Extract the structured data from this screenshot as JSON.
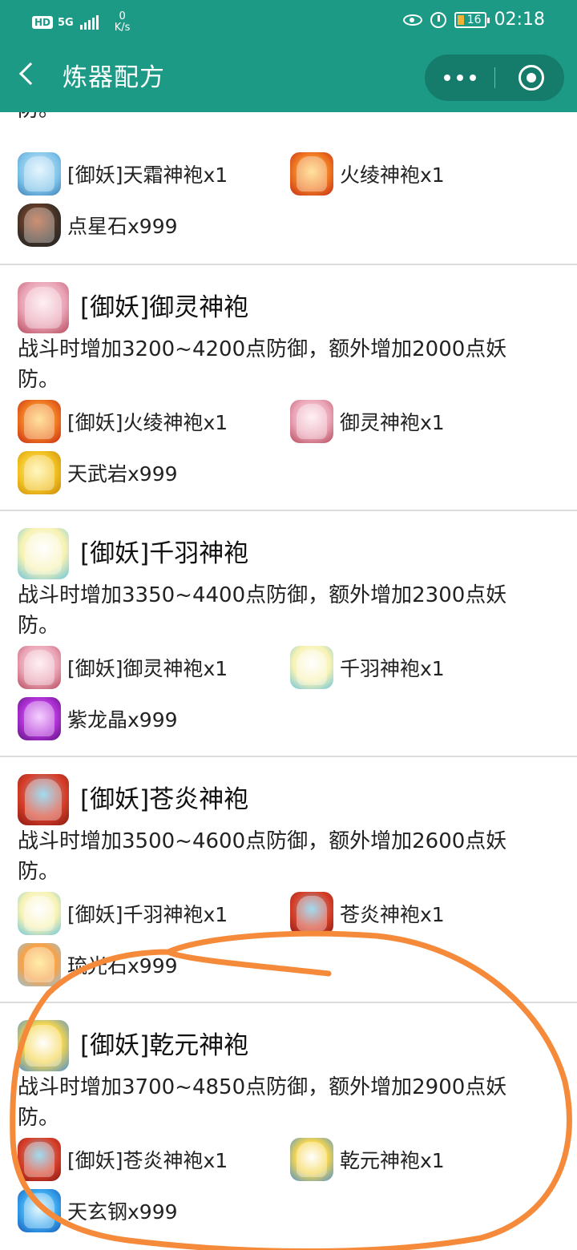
{
  "status_bar": {
    "hd": "HD",
    "network": "5G",
    "speed_value": "0",
    "speed_unit": "K/s",
    "battery": "16",
    "time": "02:18"
  },
  "nav": {
    "title": "炼器配方"
  },
  "partial_item": {
    "desc_tail": "防。",
    "materials": [
      {
        "icon": "frost-robe-icon",
        "label": "[御妖]天霜神袍x1"
      },
      {
        "icon": "fire-robe-icon",
        "label": "火绫神袍x1"
      },
      {
        "icon": "star-stone-icon",
        "label": "点星石x999"
      }
    ]
  },
  "recipes": [
    {
      "icon": "yuling-robe-icon",
      "name": "[御妖]御灵神袍",
      "desc": "战斗时增加3200~4200点防御，额外增加2000点妖防。",
      "materials": [
        {
          "icon": "fire-robe-icon",
          "label": "[御妖]火绫神袍x1"
        },
        {
          "icon": "yuling-robe-icon",
          "label": "御灵神袍x1"
        },
        {
          "icon": "tianwu-rock-icon",
          "label": "天武岩x999"
        }
      ]
    },
    {
      "icon": "qianyu-robe-icon",
      "name": "[御妖]千羽神袍",
      "desc": "战斗时增加3350~4400点防御，额外增加2300点妖防。",
      "materials": [
        {
          "icon": "yuling-robe-icon",
          "label": "[御妖]御灵神袍x1"
        },
        {
          "icon": "qianyu-robe-icon",
          "label": "千羽神袍x1"
        },
        {
          "icon": "purple-dragon-crystal-icon",
          "label": "紫龙晶x999"
        }
      ]
    },
    {
      "icon": "cangyan-robe-icon",
      "name": "[御妖]苍炎神袍",
      "desc": "战斗时增加3500~4600点防御，额外增加2600点妖防。",
      "materials": [
        {
          "icon": "qianyu-robe-icon",
          "label": "[御妖]千羽神袍x1"
        },
        {
          "icon": "cangyan-robe-icon",
          "label": "苍炎神袍x1"
        },
        {
          "icon": "liuguang-stone-icon",
          "label": "琉光石x999"
        }
      ]
    },
    {
      "icon": "qianyuan-robe-icon",
      "name": "[御妖]乾元神袍",
      "desc": "战斗时增加3700~4850点防御，额外增加2900点妖防。",
      "materials": [
        {
          "icon": "cangyan-robe-icon",
          "label": "[御妖]苍炎神袍x1"
        },
        {
          "icon": "qianyuan-robe-icon",
          "label": "乾元神袍x1"
        },
        {
          "icon": "tianxuan-steel-icon",
          "label": "天玄钢x999"
        }
      ]
    }
  ],
  "colors": {
    "header": "#1d9a86",
    "annotation": "#f58a3a"
  }
}
